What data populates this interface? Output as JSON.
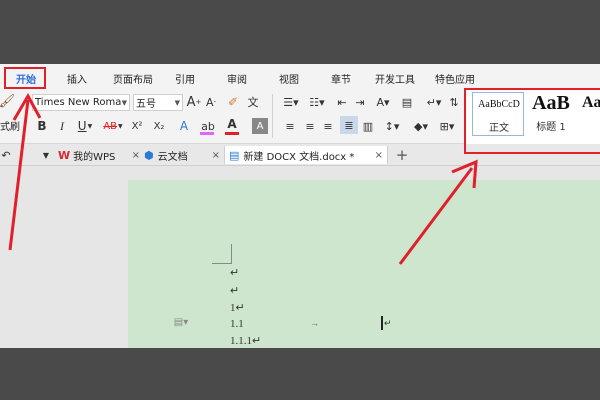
{
  "ribbon": {
    "tabs": [
      {
        "label": "开始"
      },
      {
        "label": "插入"
      },
      {
        "label": "页面布局"
      },
      {
        "label": "引用"
      },
      {
        "label": "审阅"
      },
      {
        "label": "视图"
      },
      {
        "label": "章节"
      },
      {
        "label": "开发工具"
      },
      {
        "label": "特色应用"
      }
    ],
    "font_name": "Times New Romar",
    "font_size": "五号",
    "format_label": "式刷",
    "format_painter_label": "式刷",
    "styles": [
      {
        "preview": "AaBbCcD",
        "label": "正文"
      },
      {
        "preview": "AaB",
        "label": "标题 1"
      },
      {
        "preview": "Aa",
        "label": ""
      }
    ],
    "bold": "B",
    "italic": "I",
    "underline": "U",
    "strike": "AB",
    "superscript": "X²",
    "subscript": "X₂",
    "font_color": "A"
  },
  "doc_tabs": [
    {
      "label": "我的WPS",
      "close": "×"
    },
    {
      "label": "云文档",
      "close": "×"
    },
    {
      "label": "新建 DOCX 文档.docx *",
      "close": "×"
    }
  ],
  "new_tab": "+",
  "document": {
    "lines": [
      "↵",
      "↵",
      "1↵",
      "1.1",
      "1.1.1↵"
    ],
    "arrow_mark": "→",
    "cursor_mark": "↵"
  },
  "colors": {
    "ribbon_bg": "#f3f3f3",
    "doc_bg": "#cde6cd",
    "annotation_red": "#e0202a",
    "font_color_bar": "#e0202a",
    "highlight_bar": "#e066ff"
  }
}
